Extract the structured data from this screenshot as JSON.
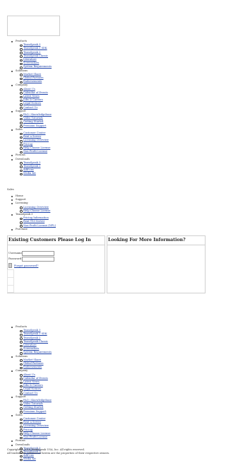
{
  "nav": [
    {
      "label": "Products",
      "children": [
        "TeamSpeak 3",
        "TeamSpeak 3 SDK",
        "TeamSpeak 2",
        "TeamSpeak Classic",
        "Literature",
        "Screenshots",
        "System Requirements"
      ]
    },
    {
      "label": "Solutions",
      "children": [
        "Market Share",
        "Global Partners",
        "Endorsements"
      ]
    },
    {
      "label": "Company",
      "children": [
        "About Us",
        "Calendar of Events",
        "Latest News",
        "Jobs & Careers",
        "Legal Notices",
        "Contact Us"
      ]
    },
    {
      "label": "Support",
      "children": [
        "FAQ / Knowledgebase",
        "Video Tutorials",
        "Getting Started",
        "Premium Support"
      ]
    },
    {
      "label": "Sales",
      "children": [
        "Customer Center",
        "Rent a Server",
        "Licensing Overview",
        "Pricing",
        "Help Choose License",
        "Non-Profit License"
      ]
    },
    {
      "label": "Forums",
      "children": []
    },
    {
      "label": "Downloads",
      "children": [
        "TeamSpeak 3",
        "TeamSpeak 2",
        "Add-ons",
        "Media Kit"
      ]
    }
  ],
  "sales_section": {
    "heading": "Sales",
    "items": [
      {
        "label": "Home",
        "children": []
      },
      {
        "label": "Support",
        "children": []
      },
      {
        "label": "Licensing",
        "children": [
          "Licensing Overview",
          "Help Choose License"
        ]
      },
      {
        "label": "TeamSpeak 3",
        "children": [
          "Pricing Information",
          "Rent TS3 Server",
          "Non-Profit License (NPL)"
        ]
      },
      {
        "label": "Purchase",
        "children": []
      }
    ]
  },
  "login": {
    "title": "Existing Customers Please Log In",
    "username_label": "Username:",
    "password_label": "Password:",
    "forgot_link": "Forgot password?"
  },
  "info": {
    "title": "Looking For More Information?"
  },
  "footer": {
    "copyright": "Copyright © 2016 TeamSpeak USA, Inc. All rights reserved.",
    "trademarks": "All trademarks referenced herein are the properties of their respective owners."
  }
}
